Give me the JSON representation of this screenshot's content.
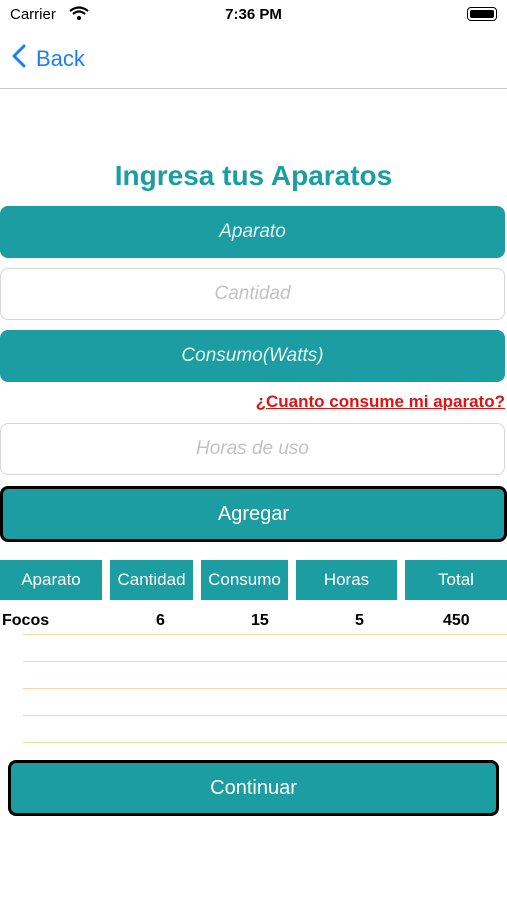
{
  "status_bar": {
    "carrier": "Carrier",
    "time": "7:36 PM"
  },
  "nav": {
    "back_label": "Back"
  },
  "page": {
    "title": "Ingresa tus Aparatos"
  },
  "form": {
    "aparato_placeholder": "Aparato",
    "cantidad_placeholder": "Cantidad",
    "consumo_placeholder": "Consumo(Watts)",
    "help_link": "¿Cuanto consume mi aparato?",
    "horas_placeholder": "Horas de uso",
    "add_button": "Agregar"
  },
  "table": {
    "headers": [
      "Aparato",
      "Cantidad",
      "Consumo",
      "Horas",
      "Total"
    ],
    "rows": [
      {
        "aparato": "Focos",
        "cantidad": "6",
        "consumo": "15",
        "horas": "5",
        "total": "450"
      }
    ]
  },
  "footer": {
    "continue_button": "Continuar"
  },
  "colors": {
    "accent": "#1b9da1",
    "link": "#e01212",
    "back": "#1a7ff5",
    "row_line": "#f5d7a0"
  },
  "icons": {
    "wifi": "wifi-icon",
    "battery": "battery-icon",
    "back": "chevron-left-icon"
  }
}
